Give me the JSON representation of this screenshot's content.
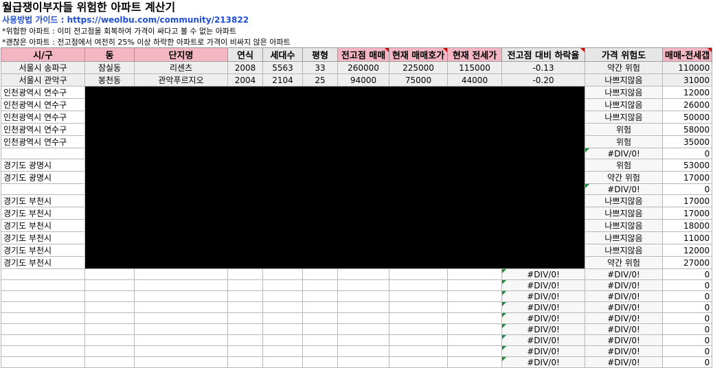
{
  "header": {
    "title": "월급쟁이부자들 위험한 아파트 계산기",
    "guide_prefix": "사용방법 가이드 : ",
    "guide_link": "https://weolbu.com/community/213822",
    "note1": "*위험한 아파트 : 이미 전고점을 회복하여 가격이 싸다고 볼 수 없는 아파트",
    "note2": "*괜찮은 아파트 : 전고점에서 여전히 25% 이상 하락한 아파트로 가격이 비싸지 않은 아파트"
  },
  "columns": [
    "시/구",
    "동",
    "단지명",
    "연식",
    "세대수",
    "평형",
    "전고점 매매",
    "현재 매매호가",
    "현재 전세가",
    "전고점 대비 하락율",
    "가격 위험도",
    "매매-전세갭"
  ],
  "visible_rows": [
    {
      "region": "서울시 송파구",
      "dong": "잠실동",
      "name": "리센츠",
      "year": "2008",
      "households": "5563",
      "size": "33",
      "peak": "260000",
      "current": "225000",
      "jeonse": "115000",
      "drop": "-0.13",
      "risk": "약간 위험",
      "gap": "110000"
    },
    {
      "region": "서울시 관악구",
      "dong": "봉천동",
      "name": "관악푸르지오",
      "year": "2004",
      "households": "2104",
      "size": "25",
      "peak": "94000",
      "current": "75000",
      "jeonse": "44000",
      "drop": "-0.20",
      "risk": "나쁘지않음",
      "gap": "31000"
    }
  ],
  "redacted_rows": [
    {
      "region": "인천광역시 연수구",
      "risk": "나쁘지않음",
      "gap": "12000"
    },
    {
      "region": "인천광역시 연수구",
      "risk": "나쁘지않음",
      "gap": "26000"
    },
    {
      "region": "인천광역시 연수구",
      "risk": "나쁘지않음",
      "gap": "50000"
    },
    {
      "region": "인천광역시 연수구",
      "risk": "위험",
      "gap": "58000"
    },
    {
      "region": "인천광역시 연수구",
      "risk": "위험",
      "gap": "35000"
    },
    {
      "region": "",
      "risk": "#DIV/0!",
      "gap": "0"
    },
    {
      "region": "경기도 광명시",
      "risk": "위험",
      "gap": "53000"
    },
    {
      "region": "경기도 광명시",
      "risk": "약간 위험",
      "gap": "17000"
    },
    {
      "region": "",
      "risk": "#DIV/0!",
      "gap": "0"
    },
    {
      "region": "경기도 부천시",
      "risk": "나쁘지않음",
      "gap": "17000"
    },
    {
      "region": "경기도 부천시",
      "risk": "나쁘지않음",
      "gap": "17000"
    },
    {
      "region": "경기도 부천시",
      "risk": "나쁘지않음",
      "gap": "18000"
    },
    {
      "region": "경기도 부천시",
      "risk": "나쁘지않음",
      "gap": "11000"
    },
    {
      "region": "경기도 부천시",
      "risk": "나쁘지않음",
      "gap": "12000"
    },
    {
      "region": "경기도 부천시",
      "risk": "약간 위험",
      "gap": "27000"
    }
  ],
  "empty_rows": {
    "drop": "#DIV/0!",
    "risk": "#DIV/0!",
    "gap": "0"
  },
  "colors": {
    "header_fill": "#f4b6c2",
    "header_gray": "#e6e6e6",
    "redaction": "#000000",
    "link": "#1e4fd6"
  }
}
